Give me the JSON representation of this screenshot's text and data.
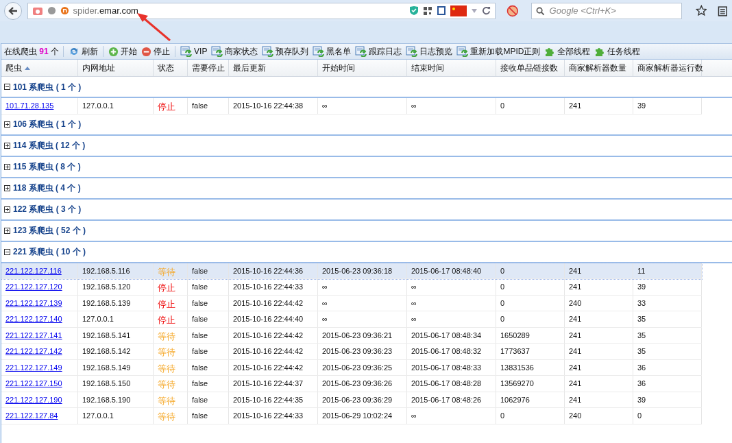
{
  "browser": {
    "address_sub": "spider.",
    "address_domain": "emar.com",
    "search": {
      "placeholder": "Google <Ctrl+K>"
    }
  },
  "toolbar": {
    "online_label": "在线爬虫",
    "online_count": "91",
    "online_unit": "个",
    "items": [
      {
        "label": "刷新",
        "kind": "refresh",
        "sep_after": true
      },
      {
        "label": "开始",
        "kind": "start",
        "sep_after": false
      },
      {
        "label": "停止",
        "kind": "stop",
        "sep_after": true
      },
      {
        "label": "VIP",
        "kind": "page",
        "sep_after": false
      },
      {
        "label": "商家状态",
        "kind": "page",
        "sep_after": false
      },
      {
        "label": "预存队列",
        "kind": "page",
        "sep_after": false
      },
      {
        "label": "黑名单",
        "kind": "page",
        "sep_after": false
      },
      {
        "label": "跟踪日志",
        "kind": "page",
        "sep_after": false
      },
      {
        "label": "日志预览",
        "kind": "page",
        "sep_after": false
      },
      {
        "label": "重新加载MPID正则",
        "kind": "page",
        "sep_after": false
      },
      {
        "label": "全部线程",
        "kind": "puzzle",
        "sep_after": false
      },
      {
        "label": "任务线程",
        "kind": "puzzle",
        "sep_after": false
      }
    ]
  },
  "table": {
    "columns": [
      "爬虫",
      "内网地址",
      "状态",
      "需要停止",
      "最后更新",
      "开始时间",
      "结束时间",
      "接收单品链接数",
      "商家解析器数量",
      "商家解析器运行数"
    ],
    "groups": [
      {
        "label": "101 系爬虫 ( 1 个 )",
        "expanded": true,
        "rows": [
          {
            "spider": "101.71.28.135",
            "ip": "127.0.0.1",
            "status": "停止",
            "stopped": true,
            "need_stop": "false",
            "updated": "2015-10-16 22:44:38",
            "start": "∞",
            "end": "∞",
            "received": "0",
            "parsers": "241",
            "running": "39",
            "selected": false
          }
        ]
      },
      {
        "label": "106 系爬虫 ( 1 个 )",
        "expanded": false
      },
      {
        "label": "114 系爬虫 ( 12 个 )",
        "expanded": false
      },
      {
        "label": "115 系爬虫 ( 8 个 )",
        "expanded": false
      },
      {
        "label": "118 系爬虫 ( 4 个 )",
        "expanded": false
      },
      {
        "label": "122 系爬虫 ( 3 个 )",
        "expanded": false
      },
      {
        "label": "123 系爬虫 ( 52 个 )",
        "expanded": false
      },
      {
        "label": "221 系爬虫 ( 10 个 )",
        "expanded": true,
        "rows": [
          {
            "spider": "221.122.127.116",
            "ip": "192.168.5.116",
            "status": "等待",
            "stopped": false,
            "need_stop": "false",
            "updated": "2015-10-16 22:44:36",
            "start": "2015-06-23 09:36:18",
            "end": "2015-06-17 08:48:40",
            "received": "0",
            "parsers": "241",
            "running": "11",
            "selected": true
          },
          {
            "spider": "221.122.127.120",
            "ip": "192.168.5.120",
            "status": "停止",
            "stopped": true,
            "need_stop": "false",
            "updated": "2015-10-16 22:44:33",
            "start": "∞",
            "end": "∞",
            "received": "0",
            "parsers": "241",
            "running": "39",
            "selected": false
          },
          {
            "spider": "221.122.127.139",
            "ip": "192.168.5.139",
            "status": "停止",
            "stopped": true,
            "need_stop": "false",
            "updated": "2015-10-16 22:44:42",
            "start": "∞",
            "end": "∞",
            "received": "0",
            "parsers": "240",
            "running": "33",
            "selected": false
          },
          {
            "spider": "221.122.127.140",
            "ip": "127.0.0.1",
            "status": "停止",
            "stopped": true,
            "need_stop": "false",
            "updated": "2015-10-16 22:44:40",
            "start": "∞",
            "end": "∞",
            "received": "0",
            "parsers": "241",
            "running": "35",
            "selected": false
          },
          {
            "spider": "221.122.127.141",
            "ip": "192.168.5.141",
            "status": "等待",
            "stopped": false,
            "need_stop": "false",
            "updated": "2015-10-16 22:44:42",
            "start": "2015-06-23 09:36:21",
            "end": "2015-06-17 08:48:34",
            "received": "1650289",
            "parsers": "241",
            "running": "35",
            "selected": false
          },
          {
            "spider": "221.122.127.142",
            "ip": "192.168.5.142",
            "status": "等待",
            "stopped": false,
            "need_stop": "false",
            "updated": "2015-10-16 22:44:42",
            "start": "2015-06-23 09:36:23",
            "end": "2015-06-17 08:48:32",
            "received": "1773637",
            "parsers": "241",
            "running": "35",
            "selected": false
          },
          {
            "spider": "221.122.127.149",
            "ip": "192.168.5.149",
            "status": "等待",
            "stopped": false,
            "need_stop": "false",
            "updated": "2015-10-16 22:44:42",
            "start": "2015-06-23 09:36:25",
            "end": "2015-06-17 08:48:33",
            "received": "13831536",
            "parsers": "241",
            "running": "36",
            "selected": false
          },
          {
            "spider": "221.122.127.150",
            "ip": "192.168.5.150",
            "status": "等待",
            "stopped": false,
            "need_stop": "false",
            "updated": "2015-10-16 22:44:37",
            "start": "2015-06-23 09:36:26",
            "end": "2015-06-17 08:48:28",
            "received": "13569270",
            "parsers": "241",
            "running": "36",
            "selected": false
          },
          {
            "spider": "221.122.127.190",
            "ip": "192.168.5.190",
            "status": "等待",
            "stopped": false,
            "need_stop": "false",
            "updated": "2015-10-16 22:44:35",
            "start": "2015-06-23 09:36:29",
            "end": "2015-06-17 08:48:26",
            "received": "1062976",
            "parsers": "241",
            "running": "39",
            "selected": false
          },
          {
            "spider": "221.122.127.84",
            "ip": "127.0.0.1",
            "status": "等待",
            "stopped": false,
            "need_stop": "false",
            "updated": "2015-10-16 22:44:33",
            "start": "2015-06-29 10:02:24",
            "end": "∞",
            "received": "0",
            "parsers": "240",
            "running": "0",
            "selected": false
          }
        ]
      }
    ]
  }
}
